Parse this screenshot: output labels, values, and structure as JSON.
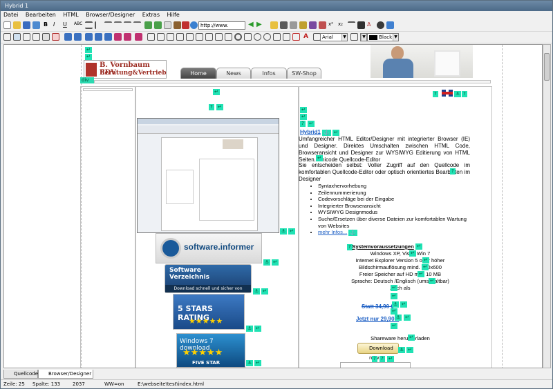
{
  "window": {
    "title": "Hybrid 1"
  },
  "menu": [
    "Datei",
    "Bearbeiten",
    "HTML",
    "Browser/Designer",
    "Extras",
    "Hilfe"
  ],
  "toolbar": {
    "url_value": "http://www.",
    "font_value": "Arial",
    "color_value": "Black"
  },
  "page": {
    "logo_line1": "B. Vornbaum EDV",
    "logo_line2": "Beratung&Vertrieb",
    "nav_tabs": [
      "Home",
      "News",
      "Infos",
      "SW-Shop"
    ],
    "div_tag": "div",
    "intro_link": "Hybrid1",
    "intro_p1": "Umfangreicher HTML Editor/Designer mit integrierter Browser (IE) und Designer. Direktes Umschalten zwischen HTML Code, Browseransicht und Designer zur WYSIWYG Editierung von HTML Seiten. Unicode Quellcode-Editor",
    "intro_p2": "Sie entscheiden selbst: Voller Zugriff auf den Quellcode im komfortablen Quellcode-Editor oder optisch orientiertes Bearbeiten im Designer",
    "features": [
      "Syntaxhervorhebung",
      "Zeilennummerierung",
      "Codevorschläge bei der Eingabe",
      "Integrierter Browseransicht",
      "WYSIWYG Designmodus",
      "Suche/Ersetzen über diverse Dateien zur komfortablen Wartung von Websites"
    ],
    "more_link": "mehr Infos...",
    "req_title": "Systemvoraussetzungen",
    "requirements": [
      "Windows XP, Vista, Win 7",
      "Internet Explorer Version 5 oder höher",
      "Bildschirmauflösung mind. 800x600",
      "Freier Speicher auf HD min. 10 MB",
      "Sprache: Deutsch /Englisch (umschaltbar)",
      "Auch als"
    ],
    "price_old": "Statt 34,90 €",
    "price_new": "Jetzt nur 29,90 €",
    "shareware": "Shareware herunterladen",
    "download_btn": "Download now",
    "badges": {
      "software_informer": "software.informer",
      "sv_title1": "Software",
      "sv_title2": "Verzeichnis",
      "sv_bottom": "Download schnell und sicher von heise.de",
      "gd_title": "5 STARS RATING",
      "gd_stars": "★★★★★",
      "w7_title": "Windows 7 download",
      "w7_stars": "★★★★★",
      "w7_bottom": "FIVE STAR"
    }
  },
  "bottom_tabs": [
    "Quellcode",
    "Browser/Designer"
  ],
  "status": {
    "zeile": "Zeile:  25",
    "spalte": "Spalte: 133",
    "count": "2037",
    "ww": "WW=on",
    "path": "E:\\webseite\\test\\index.html"
  }
}
